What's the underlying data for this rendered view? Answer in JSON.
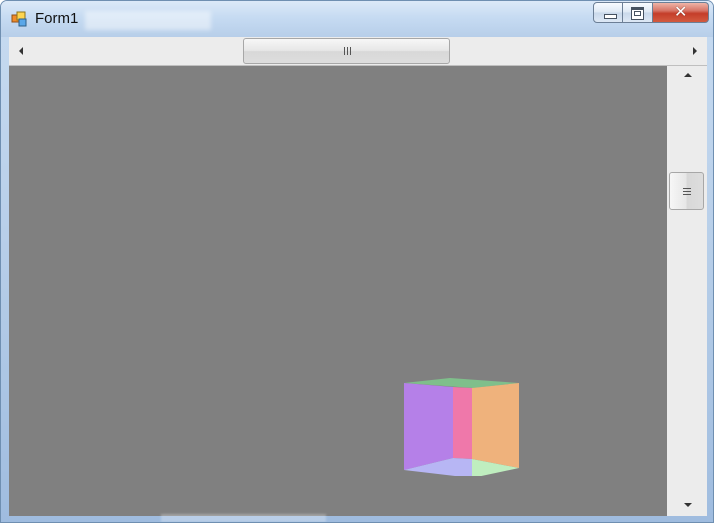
{
  "window": {
    "title": "Form1",
    "colors": {
      "frame": "#b8cfe9",
      "viewport": "#808080",
      "cube_top": "#7fbf8b",
      "cube_left": "#b580e8",
      "cube_inner_pink": "#ef78aa",
      "cube_right": "#efb27c",
      "cube_bottom_left": "#b7b6f4",
      "cube_bottom_right": "#bfeebf"
    }
  },
  "titlebar": {
    "icon": "windows-form-icon",
    "minimize_icon": "minimize-icon",
    "maximize_icon": "maximize-icon",
    "close_icon": "close-icon",
    "close_glyph": "✕"
  },
  "scrollbars": {
    "horizontal": {
      "left_icon": "chevron-left-icon",
      "right_icon": "chevron-right-icon",
      "thumb_icon": "grip-icon"
    },
    "vertical": {
      "up_icon": "chevron-up-icon",
      "down_icon": "chevron-down-icon",
      "thumb_icon": "grip-icon"
    }
  },
  "scene": {
    "object": "cube-3d"
  }
}
